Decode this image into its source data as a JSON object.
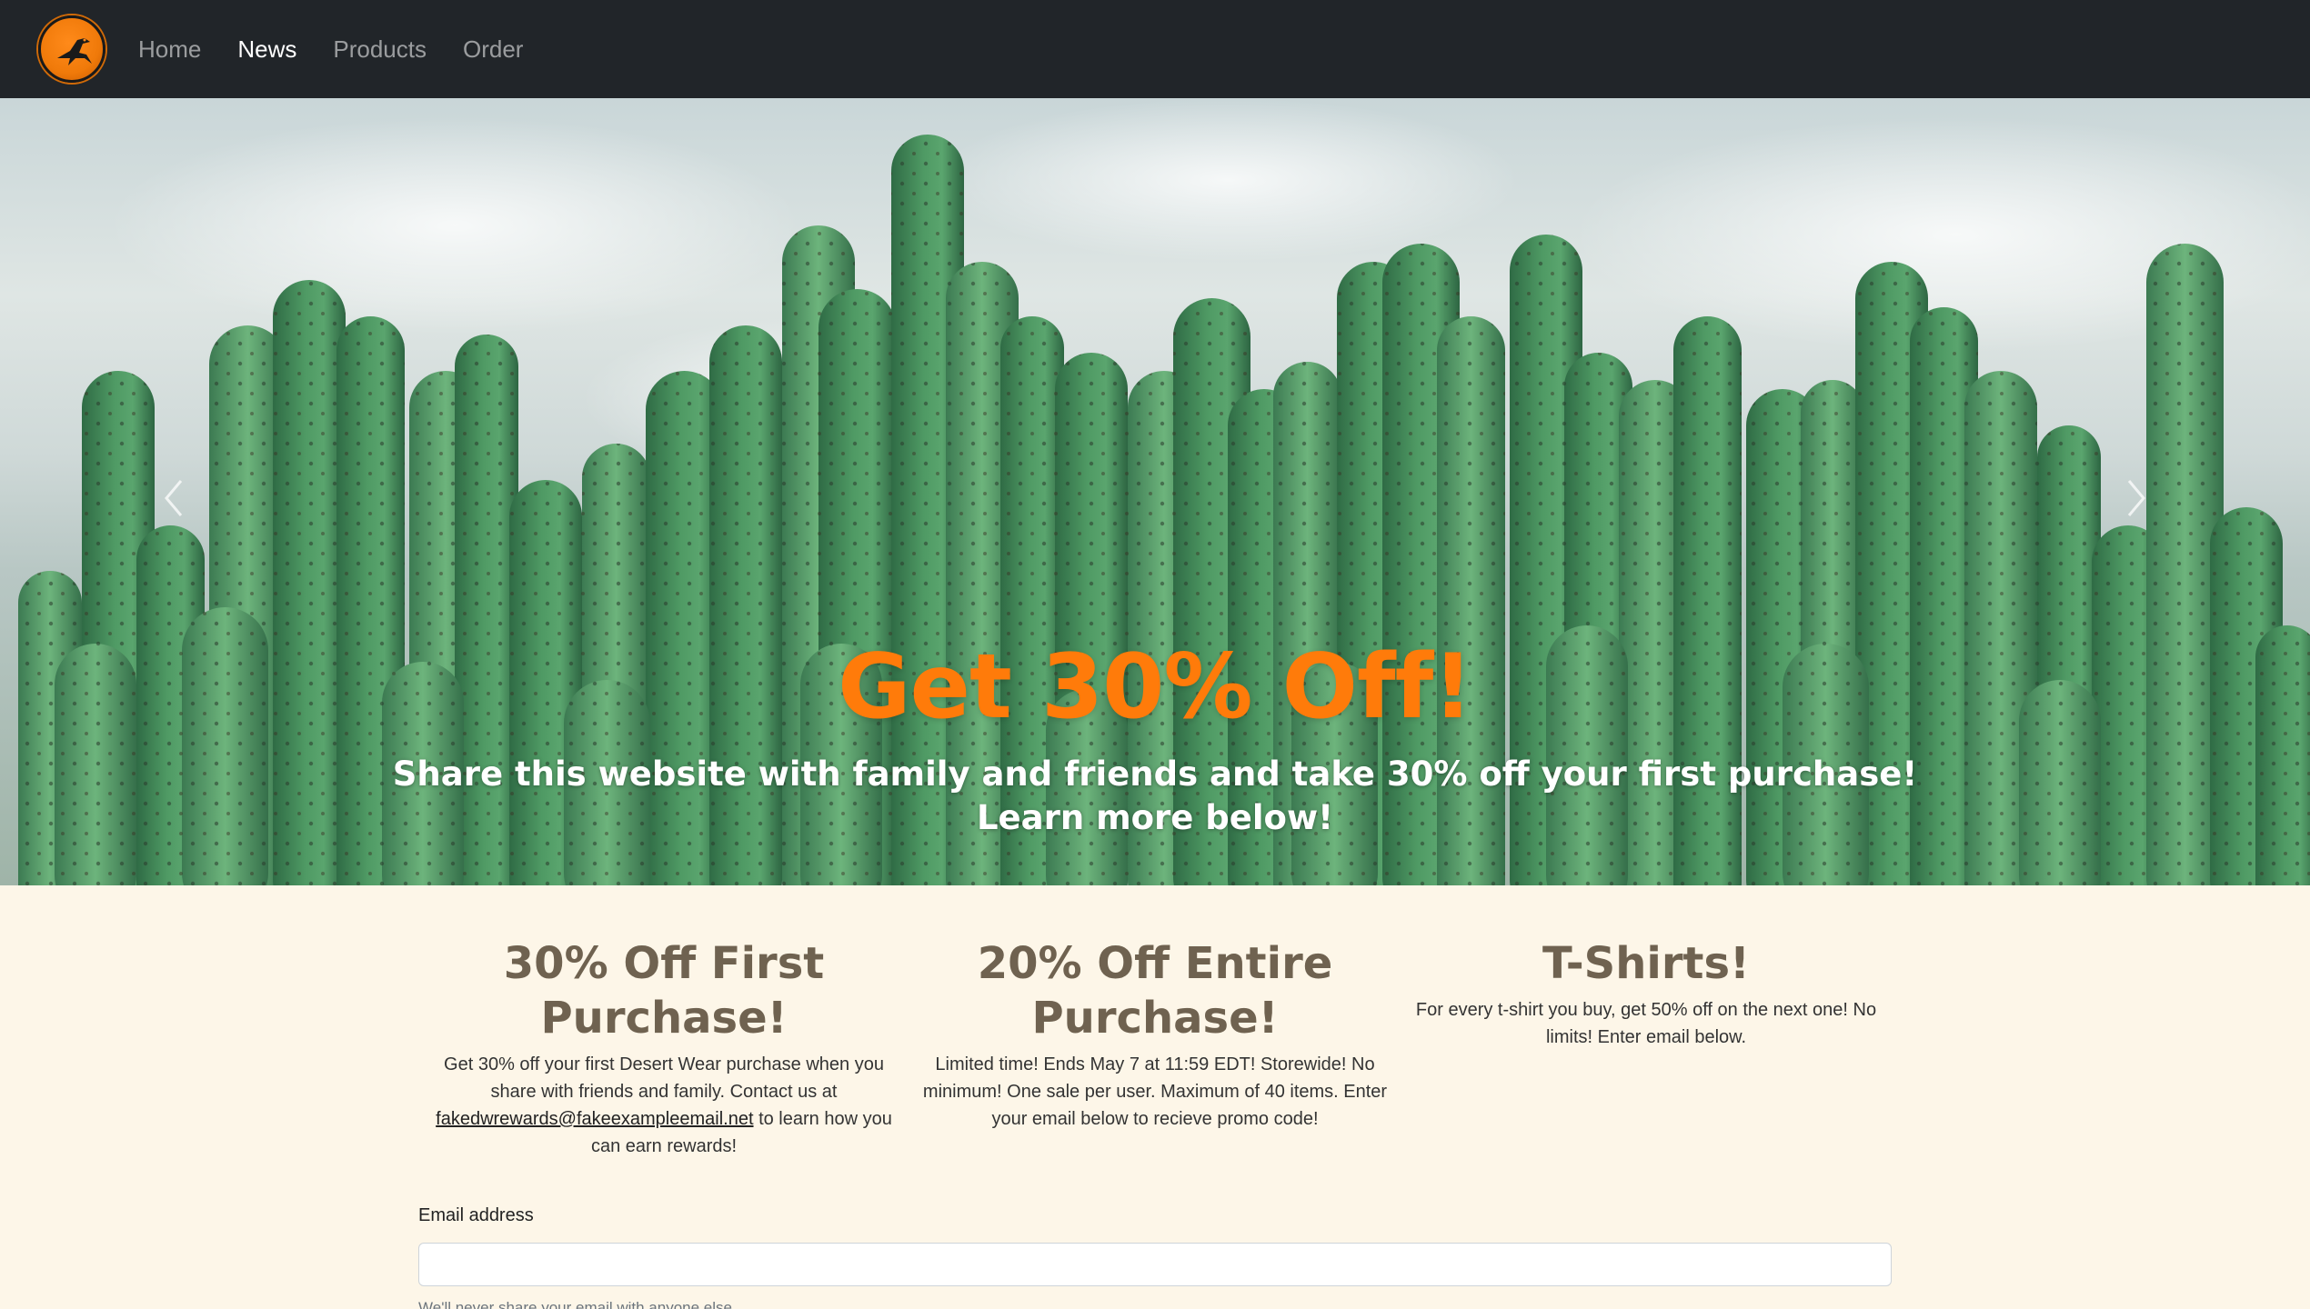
{
  "nav": {
    "logo_icon": "roadrunner-logo",
    "links": [
      {
        "label": "Home",
        "active": false
      },
      {
        "label": "News",
        "active": true
      },
      {
        "label": "Products",
        "active": false
      },
      {
        "label": "Order",
        "active": false
      }
    ]
  },
  "hero": {
    "title": "Get 30% Off!",
    "subtitle": "Share this website with family and friends and take 30% off your first purchase! Learn more below!",
    "prev_icon": "chevron-left-icon",
    "next_icon": "chevron-right-icon",
    "slide_count": 3,
    "active_slide": 1
  },
  "promos": [
    {
      "title": "30% Off First Purchase!",
      "text_before": "Get 30% off your first Desert Wear purchase when you share with friends and family. Contact us at ",
      "link": "fakedwrewards@fakeexampleemail.net",
      "text_after": " to learn how you can earn rewards!"
    },
    {
      "title": "20% Off Entire Purchase!",
      "text": "Limited time! Ends May 7 at 11:59 EDT! Storewide! No minimum! One sale per user. Maximum of 40 items. Enter your email below to recieve promo code!"
    },
    {
      "title": "T-Shirts!",
      "text": "For every t-shirt you buy, get 50% off on the next one! No limits! Enter email below."
    }
  ],
  "form": {
    "email_label": "Email address",
    "email_value": "",
    "email_placeholder": "",
    "help_text": "We'll never share your email with anyone else."
  },
  "colors": {
    "navbar_bg": "#212529",
    "accent_orange": "#ff7b0a",
    "promo_title": "#6f6250",
    "page_bg": "#fdf6e8"
  }
}
